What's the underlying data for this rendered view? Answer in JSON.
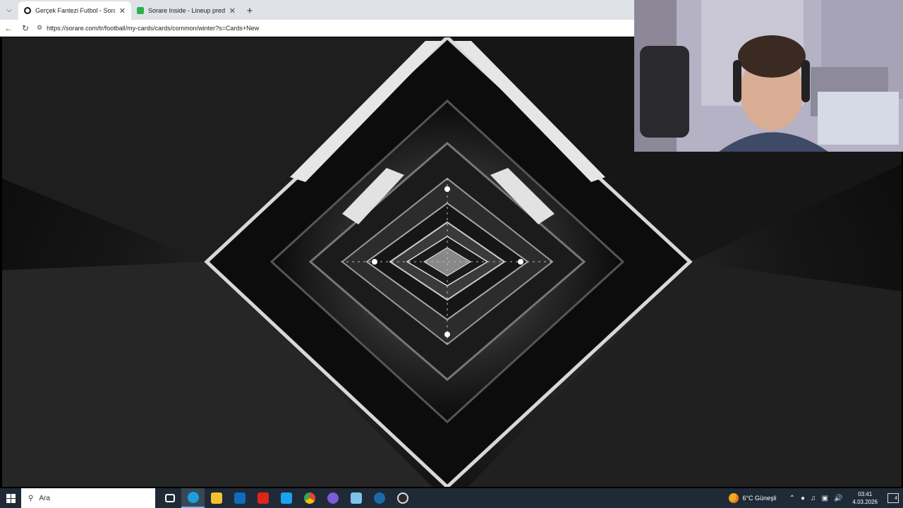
{
  "browser": {
    "tabs": [
      {
        "title": "Gerçek Fantezi Futbol - Sorare Foo",
        "active": true,
        "favicon": "sorare-icon"
      },
      {
        "title": "Sorare Inside - Lineup predictions",
        "active": false,
        "favicon": "sorare-inside-icon"
      }
    ],
    "new_tab_label": "+",
    "url": "https://sorare.com/tr/football/my-cards/cards/common/winter?s=Cards+New"
  },
  "taskbar": {
    "search_placeholder": "Ara",
    "apps": [
      {
        "name": "task-view-icon",
        "color": "#1f2a36"
      },
      {
        "name": "edge-icon",
        "color": "#1aa0d8"
      },
      {
        "name": "file-explorer-icon",
        "color": "#f2c230"
      },
      {
        "name": "outlook-icon",
        "color": "#0f6cbd"
      },
      {
        "name": "youtube-icon",
        "color": "#e0241b"
      },
      {
        "name": "twitter-icon",
        "color": "#1da1f2"
      },
      {
        "name": "chrome-icon",
        "color": "#34a853"
      },
      {
        "name": "discord-icon",
        "color": "#7b5cd6"
      },
      {
        "name": "notepad-icon",
        "color": "#7ec4e8"
      },
      {
        "name": "steam-icon",
        "color": "#1b6aa5"
      },
      {
        "name": "obs-icon",
        "color": "#2b2b2b"
      }
    ],
    "weather": "6°C Güneşli",
    "time": "03:41",
    "date": "4.03.2026",
    "notification_count": "4"
  },
  "colors": {
    "taskbar_bg": "#1f2a36",
    "tabbar_bg": "#dfe3e8"
  }
}
